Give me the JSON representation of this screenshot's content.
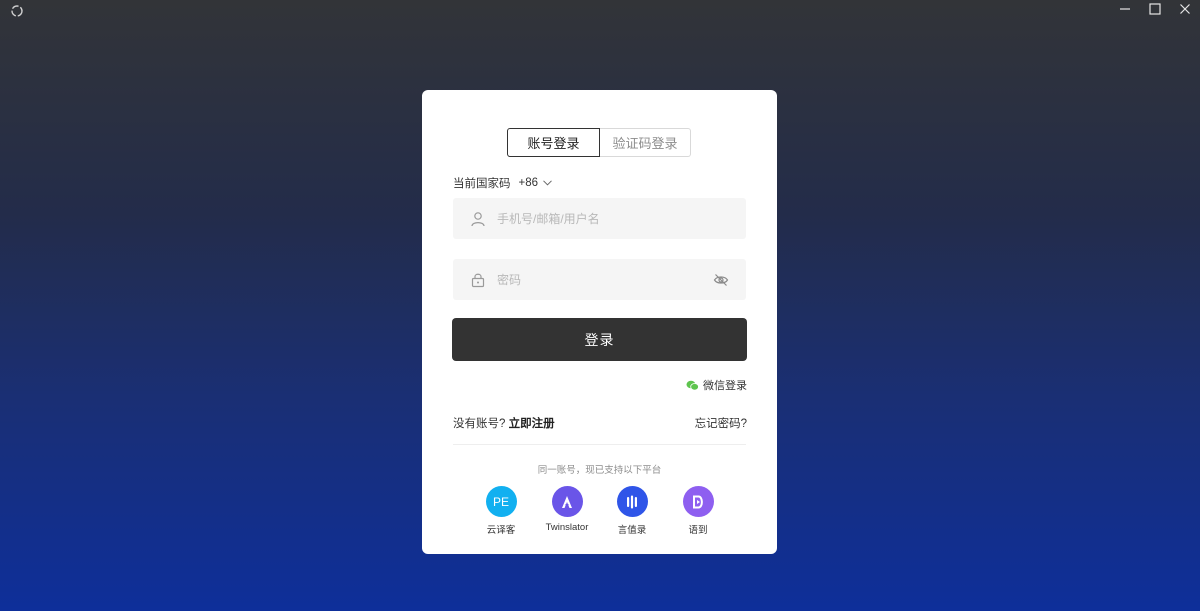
{
  "tabs": {
    "account": "账号登录",
    "code": "验证码登录"
  },
  "country": {
    "label": "当前国家码",
    "code": "+86"
  },
  "username": {
    "placeholder": "手机号/邮箱/用户名",
    "value": ""
  },
  "password": {
    "placeholder": "密码",
    "value": ""
  },
  "login_button": "登录",
  "wechat_login": "微信登录",
  "register": {
    "prompt": "没有账号?",
    "link": "立即注册"
  },
  "forgot_password": "忘记密码?",
  "support_text": "同一账号，现已支持以下平台",
  "apps": [
    {
      "name": "云译客",
      "icon_text": "PE",
      "color": "#12b0f0"
    },
    {
      "name": "Twinslator",
      "icon": "twinslator-icon",
      "color": "#6a55e8"
    },
    {
      "name": "言值录",
      "icon": "yanzhilu-icon",
      "color": "#2f55e8"
    },
    {
      "name": "语到",
      "icon": "yudao-icon",
      "color": "#8e5ff0"
    }
  ],
  "colors": {
    "primary_button": "#333333",
    "wechat_green": "#5ec44e",
    "card_bg": "#ffffff"
  }
}
